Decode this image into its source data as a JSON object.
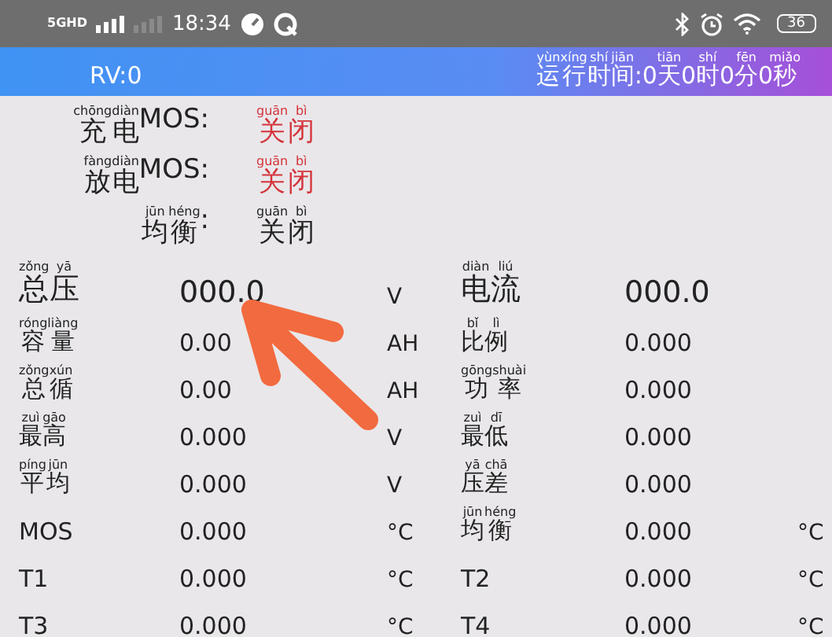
{
  "status_bar": {
    "network": "5GHD",
    "time": "18:34",
    "battery": "36"
  },
  "header": {
    "left": "RV:0",
    "right": [
      {
        "text": "运",
        "pinyin": "yùn"
      },
      {
        "text": "行",
        "pinyin": "xíng"
      },
      {
        "text": "时",
        "pinyin": "shí"
      },
      {
        "text": "间",
        "pinyin": "jiān"
      },
      {
        "text": ":0"
      },
      {
        "text": "天",
        "pinyin": "tiān"
      },
      {
        "text": "0"
      },
      {
        "text": "时",
        "pinyin": "shí"
      },
      {
        "text": "0"
      },
      {
        "text": "分",
        "pinyin": "fēn"
      },
      {
        "text": "0"
      },
      {
        "text": "秒",
        "pinyin": "miǎo"
      }
    ]
  },
  "switches": [
    {
      "label": [
        {
          "text": "充",
          "pinyin": "chōng"
        },
        {
          "text": "电",
          "pinyin": "diàn"
        },
        {
          "text": "MOS:"
        }
      ],
      "status": [
        {
          "text": "关",
          "pinyin": "guān"
        },
        {
          "text": "闭",
          "pinyin": "bì"
        }
      ],
      "color": "#d4343a"
    },
    {
      "label": [
        {
          "text": "放",
          "pinyin": "fàng"
        },
        {
          "text": "电",
          "pinyin": "diàn"
        },
        {
          "text": "MOS:"
        }
      ],
      "status": [
        {
          "text": "关",
          "pinyin": "guān"
        },
        {
          "text": "闭",
          "pinyin": "bì"
        }
      ],
      "color": "#d4343a"
    },
    {
      "label": [
        {
          "text": "均",
          "pinyin": "jūn"
        },
        {
          "text": "衡",
          "pinyin": "héng"
        },
        {
          "text": ":"
        }
      ],
      "status": [
        {
          "text": "关",
          "pinyin": "guān"
        },
        {
          "text": "闭",
          "pinyin": "bì"
        }
      ],
      "color": "#222222"
    }
  ],
  "readings": {
    "left": [
      {
        "kind": "large",
        "label": [
          {
            "text": "总",
            "pinyin": "zǒng"
          },
          {
            "text": "压",
            "pinyin": "yā"
          }
        ],
        "value": "000.0",
        "unit": "V"
      },
      {
        "kind": "small",
        "label": [
          {
            "text": "容",
            "pinyin": "róng"
          },
          {
            "text": "量",
            "pinyin": "liàng"
          }
        ],
        "value": "0.00",
        "unit": "AH"
      },
      {
        "kind": "small",
        "label": [
          {
            "text": "总",
            "pinyin": "zǒng"
          },
          {
            "text": "循",
            "pinyin": "xún"
          }
        ],
        "value": "0.00",
        "unit": "AH"
      },
      {
        "kind": "small",
        "label": [
          {
            "text": "最",
            "pinyin": "zuì"
          },
          {
            "text": "高",
            "pinyin": "gāo"
          }
        ],
        "value": "0.000",
        "unit": "V"
      },
      {
        "kind": "small",
        "label": [
          {
            "text": "平",
            "pinyin": "píng"
          },
          {
            "text": "均",
            "pinyin": "jūn"
          }
        ],
        "value": "0.000",
        "unit": "V"
      },
      {
        "kind": "small",
        "label": [
          {
            "text": "MOS"
          }
        ],
        "value": "0.000",
        "unit": "°C"
      },
      {
        "kind": "small",
        "label": [
          {
            "text": "T1"
          }
        ],
        "value": "0.000",
        "unit": "°C"
      },
      {
        "kind": "small",
        "label": [
          {
            "text": "T3"
          }
        ],
        "value": "0.000",
        "unit": "°C"
      }
    ],
    "right": [
      {
        "kind": "large",
        "label": [
          {
            "text": "电",
            "pinyin": "diàn"
          },
          {
            "text": "流",
            "pinyin": "liú"
          }
        ],
        "value": "000.0"
      },
      {
        "kind": "small",
        "label": [
          {
            "text": "比",
            "pinyin": "bǐ"
          },
          {
            "text": "例",
            "pinyin": "lì"
          }
        ],
        "value": "0.000"
      },
      {
        "kind": "small",
        "label": [
          {
            "text": "功",
            "pinyin": "gōng"
          },
          {
            "text": "率",
            "pinyin": "shuài"
          }
        ],
        "value": "0.000"
      },
      {
        "kind": "small",
        "label": [
          {
            "text": "最",
            "pinyin": "zuì"
          },
          {
            "text": "低",
            "pinyin": "dī"
          }
        ],
        "value": "0.000"
      },
      {
        "kind": "small",
        "label": [
          {
            "text": "压",
            "pinyin": "yā"
          },
          {
            "text": "差",
            "pinyin": "chā"
          }
        ],
        "value": "0.000"
      },
      {
        "kind": "small",
        "label": [
          {
            "text": "均",
            "pinyin": "jūn"
          },
          {
            "text": "衡",
            "pinyin": "héng"
          }
        ],
        "value": "0.000",
        "unit": "°C"
      },
      {
        "kind": "small",
        "label": [
          {
            "text": "T2"
          }
        ],
        "value": "0.000",
        "unit": "°C"
      },
      {
        "kind": "small",
        "label": [
          {
            "text": "T4"
          }
        ],
        "value": "0.000",
        "unit": "°C"
      }
    ]
  }
}
